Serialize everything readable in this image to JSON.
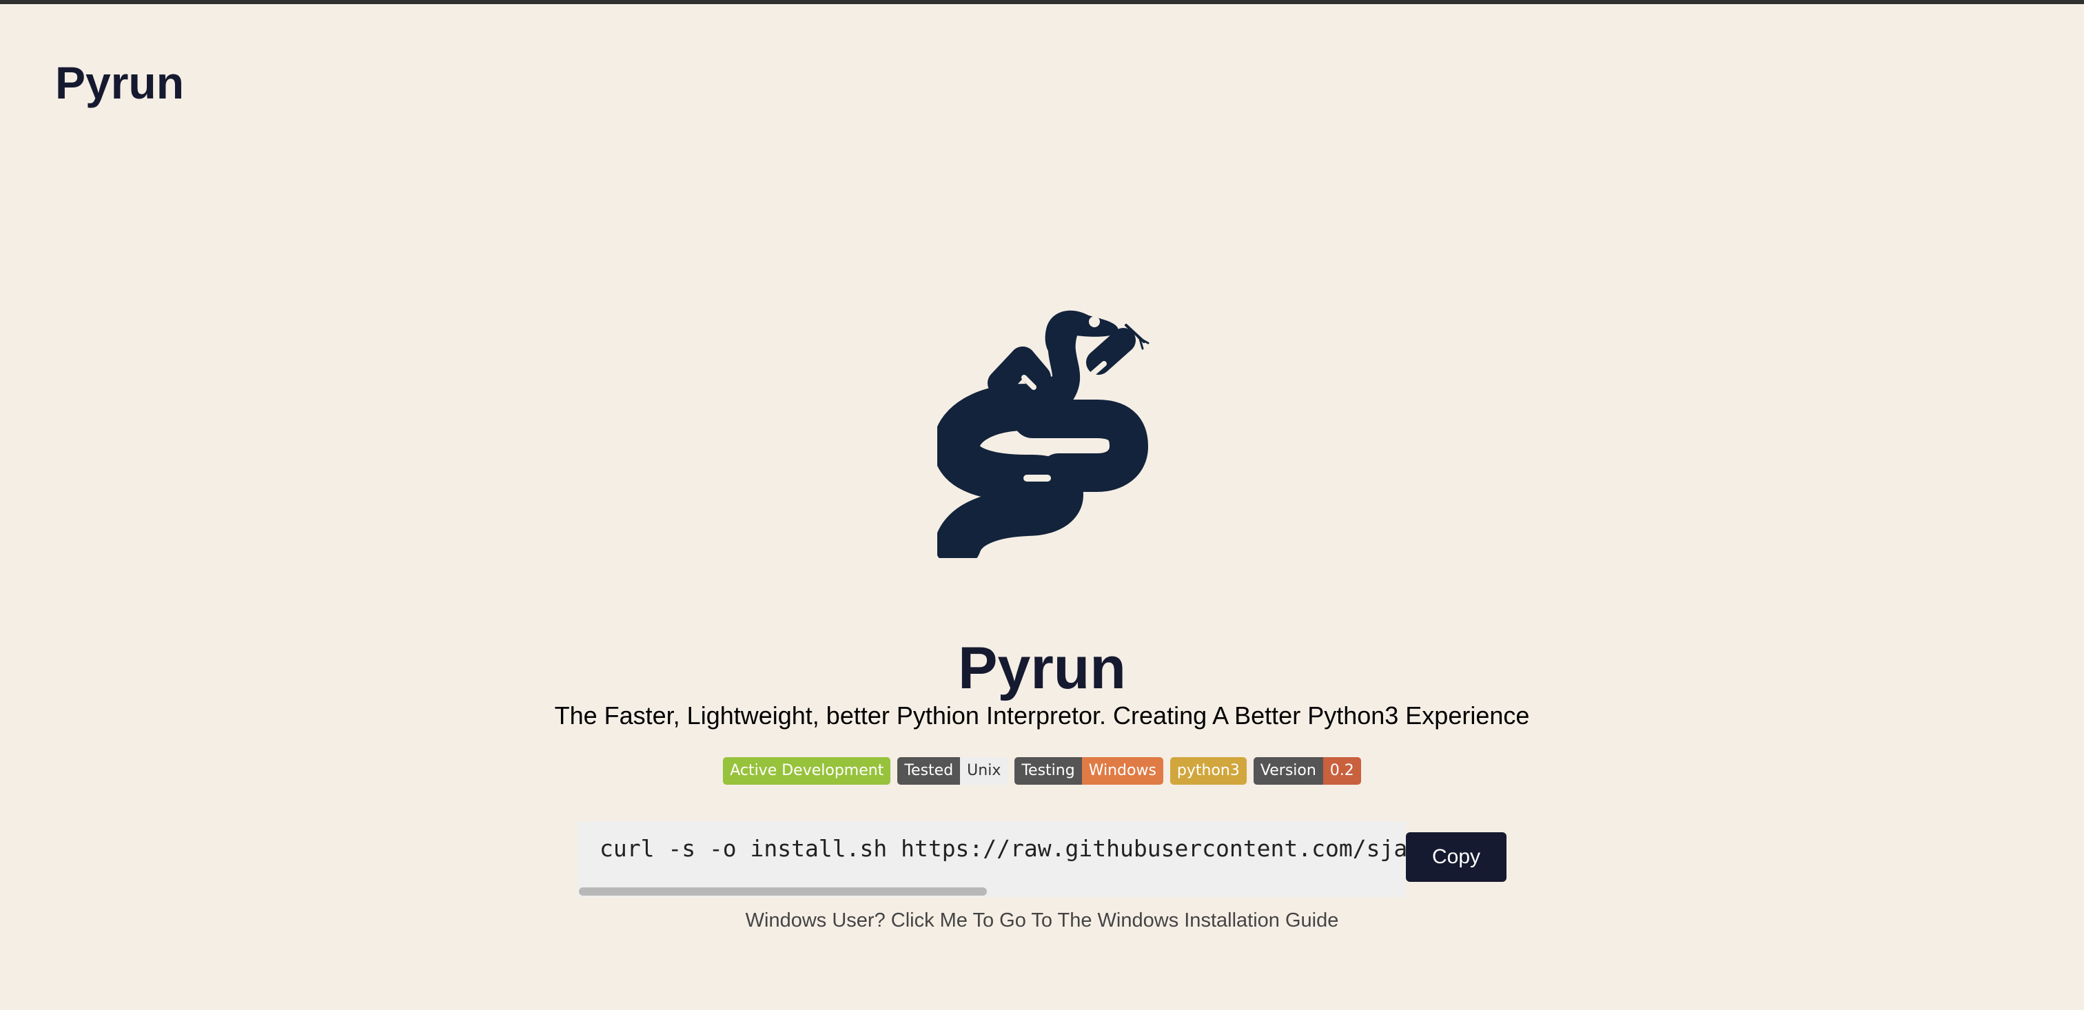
{
  "site_title": "Pyrun",
  "hero": {
    "title": "Pyrun",
    "tagline": "The Faster, Lightweight, better Pythion Interpretor. Creating A Better Python3 Experience"
  },
  "logo": {
    "icon": "snake-icon",
    "color": "#12233b"
  },
  "badges": [
    {
      "left": "Active Development",
      "right": "",
      "left_color": "#97c23c",
      "right_color": ""
    },
    {
      "left": "Tested",
      "right": "Unix",
      "left_color": "#555555",
      "right_color": "#eeeeee"
    },
    {
      "left": "Testing",
      "right": "Windows",
      "left_color": "#555555",
      "right_color": "#e07b45"
    },
    {
      "left": "python3",
      "right": "",
      "left_color": "#d1a63d",
      "right_color": ""
    },
    {
      "left": "Version",
      "right": "0.2",
      "left_color": "#555555",
      "right_color": "#c9603e"
    }
  ],
  "install": {
    "command": "curl -s -o install.sh https://raw.githubusercontent.com/sjapanwala/pyrun/main/install.sh && bash install.sh",
    "copy_label": "Copy"
  },
  "windows_link": "Windows User? Click Me To Go To The Windows Installation Guide",
  "colors": {
    "background": "#f5eee5",
    "primary": "#161a30"
  }
}
